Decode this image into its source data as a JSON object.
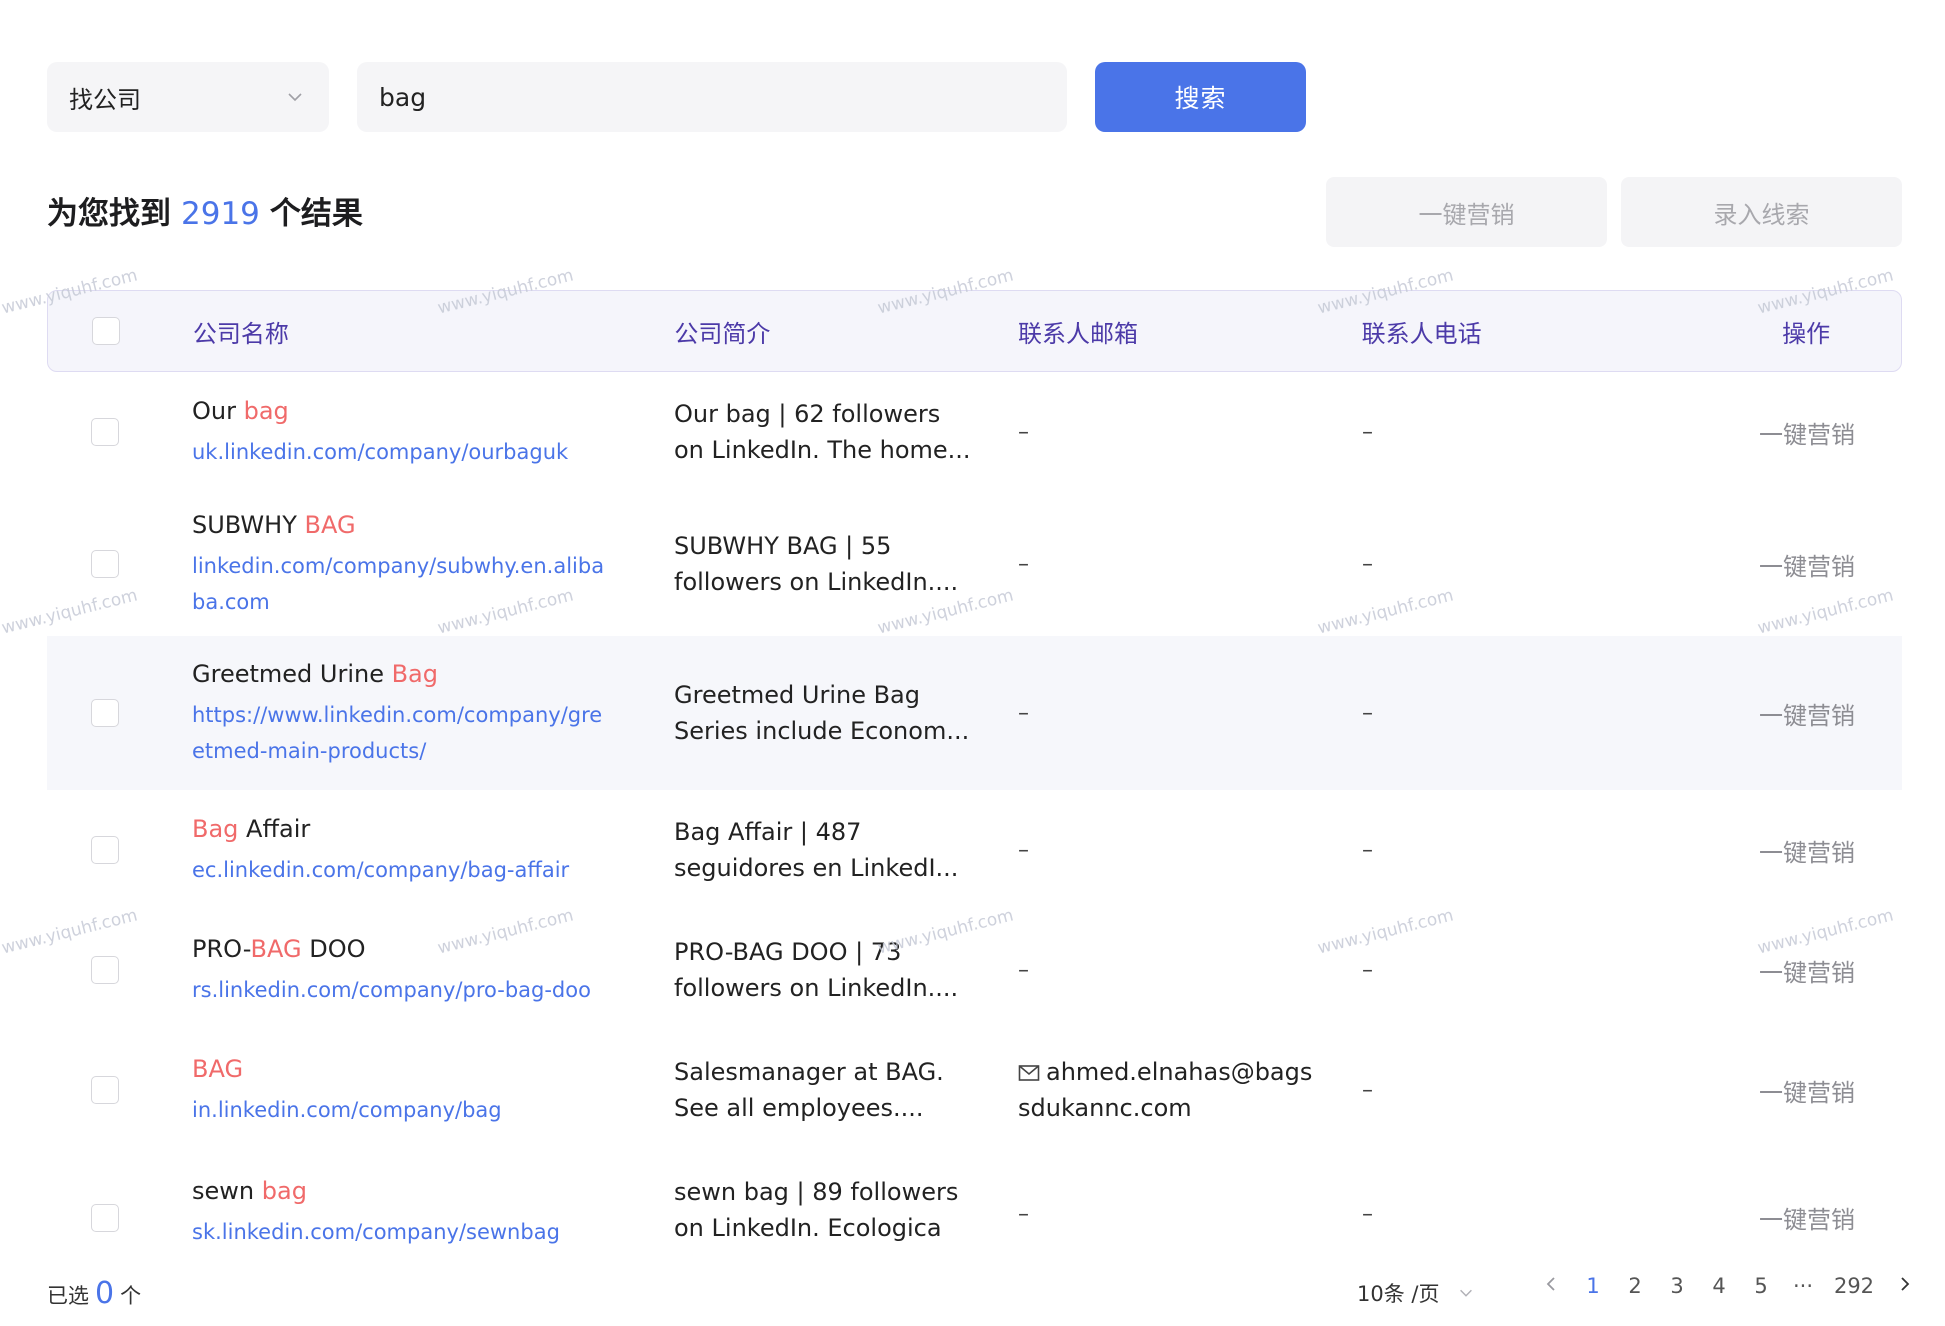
{
  "search": {
    "type_label": "找公司",
    "query": "bag",
    "button_label": "搜索"
  },
  "results": {
    "prefix": "为您找到",
    "count": "2919",
    "suffix": "个结果"
  },
  "bulk_actions": {
    "marketing": "一键营销",
    "add_leads": "录入线索"
  },
  "table": {
    "headers": {
      "name": "公司名称",
      "desc": "公司简介",
      "email": "联系人邮箱",
      "phone": "联系人电话",
      "op": "操作"
    },
    "rows": [
      {
        "name_pre": "Our ",
        "name_hl": "bag",
        "name_post": "",
        "link": "uk.linkedin.com/company/ourbaguk",
        "desc1": "Our bag | 62 followers",
        "desc2": "on LinkedIn. The home...",
        "email": "–",
        "phone": "–",
        "op": "一键营销"
      },
      {
        "name_pre": "SUBWHY ",
        "name_hl": "BAG",
        "name_post": "",
        "link": "linkedin.com/company/subwhy.en.alibaba.com",
        "desc1": "SUBWHY BAG | 55",
        "desc2": "followers on LinkedIn....",
        "email": "–",
        "phone": "–",
        "op": "一键营销"
      },
      {
        "name_pre": "Greetmed Urine ",
        "name_hl": "Bag",
        "name_post": "",
        "link": "https://www.linkedin.com/company/greetmed-main-products/",
        "desc1": "Greetmed Urine Bag",
        "desc2": "Series include Econom...",
        "email": "–",
        "phone": "–",
        "op": "一键营销"
      },
      {
        "name_pre": "",
        "name_hl": "Bag",
        "name_post": " Affair",
        "link": "ec.linkedin.com/company/bag-affair",
        "desc1": "Bag Affair | 487",
        "desc2": "seguidores en LinkedI...",
        "email": "–",
        "phone": "–",
        "op": "一键营销"
      },
      {
        "name_pre": "PRO-",
        "name_hl": "BAG",
        "name_post": " DOO",
        "link": "rs.linkedin.com/company/pro-bag-doo",
        "desc1": "PRO-BAG DOO | 73",
        "desc2": "followers on LinkedIn....",
        "email": "–",
        "phone": "–",
        "op": "一键营销"
      },
      {
        "name_pre": "",
        "name_hl": "BAG",
        "name_post": "",
        "link": "in.linkedin.com/company/bag",
        "desc1": "Salesmanager at BAG.",
        "desc2": "See all employees....",
        "email1": "ahmed.elnahas@bags",
        "email2": "sdukannc.com",
        "phone": "–",
        "op": "一键营销"
      },
      {
        "name_pre": "sewn ",
        "name_hl": "bag",
        "name_post": "",
        "link": "sk.linkedin.com/company/sewnbag",
        "desc1": "sewn bag | 89 followers",
        "desc2": "on LinkedIn. Ecologica",
        "email": "–",
        "phone": "–",
        "op": "一键营销"
      }
    ]
  },
  "footer": {
    "selected_label": "已选",
    "selected_count": "0",
    "selected_unit": "个",
    "page_size": "10条 /页",
    "pages": [
      "1",
      "2",
      "3",
      "4",
      "5",
      "···",
      "292"
    ],
    "current_page": "1"
  },
  "watermark": "www.yiquhf.com",
  "colors": {
    "accent": "#4a74e8",
    "highlight": "#f06a6a",
    "header_text": "#4c3aa8"
  },
  "icons": [
    "chevron-down-icon",
    "mail-icon",
    "chevron-left-icon",
    "chevron-right-icon"
  ]
}
